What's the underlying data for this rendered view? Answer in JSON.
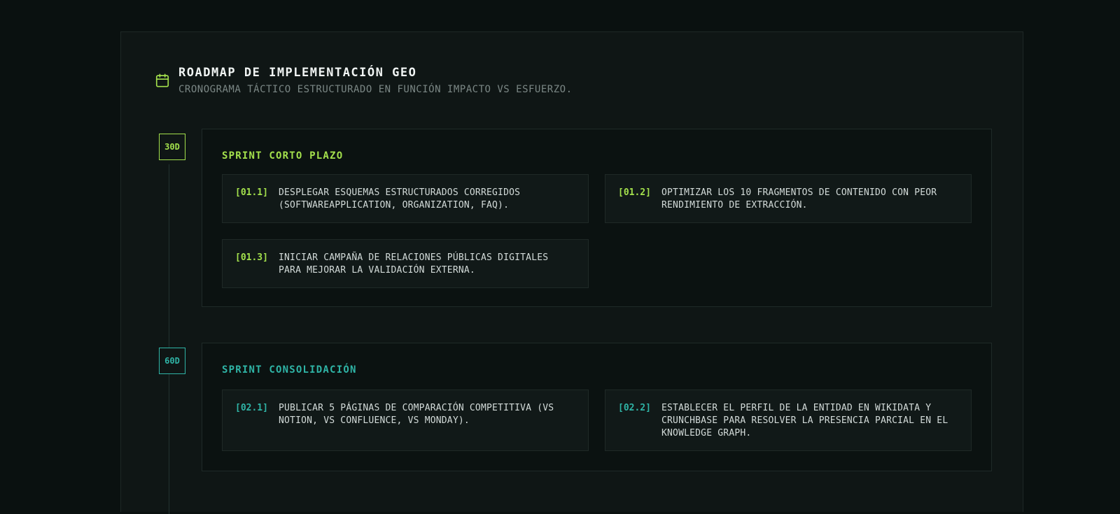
{
  "header": {
    "title": "ROADMAP DE IMPLEMENTACIÓN GEO",
    "subtitle": "CRONOGRAMA TÁCTICO ESTRUCTURADO EN FUNCIÓN IMPACTO VS ESFUERZO.",
    "icon": "calendar-icon"
  },
  "colors": {
    "green": "#a3e04c",
    "teal": "#2fb4a6",
    "background": "#0a1110"
  },
  "sprints": [
    {
      "badge": "30D",
      "title": "SPRINT CORTO PLAZO",
      "tasks": [
        {
          "code": "[01.1]",
          "text": "DESPLEGAR ESQUEMAS ESTRUCTURADOS CORREGIDOS (SOFTWAREAPPLICATION, ORGANIZATION, FAQ)."
        },
        {
          "code": "[01.2]",
          "text": "OPTIMIZAR LOS 10 FRAGMENTOS DE CONTENIDO CON PEOR RENDIMIENTO DE EXTRACCIÓN."
        },
        {
          "code": "[01.3]",
          "text": "INICIAR CAMPAÑA DE RELACIONES PÚBLICAS DIGITALES PARA MEJORAR LA VALIDACIÓN EXTERNA."
        }
      ]
    },
    {
      "badge": "60D",
      "title": "SPRINT CONSOLIDACIÓN",
      "tasks": [
        {
          "code": "[02.1]",
          "text": "PUBLICAR 5 PÁGINAS DE COMPARACIÓN COMPETITIVA (VS NOTION, VS CONFLUENCE, VS MONDAY)."
        },
        {
          "code": "[02.2]",
          "text": "ESTABLECER EL PERFIL DE LA ENTIDAD EN WIKIDATA Y CRUNCHBASE PARA RESOLVER LA PRESENCIA PARCIAL EN EL KNOWLEDGE GRAPH."
        }
      ]
    }
  ]
}
